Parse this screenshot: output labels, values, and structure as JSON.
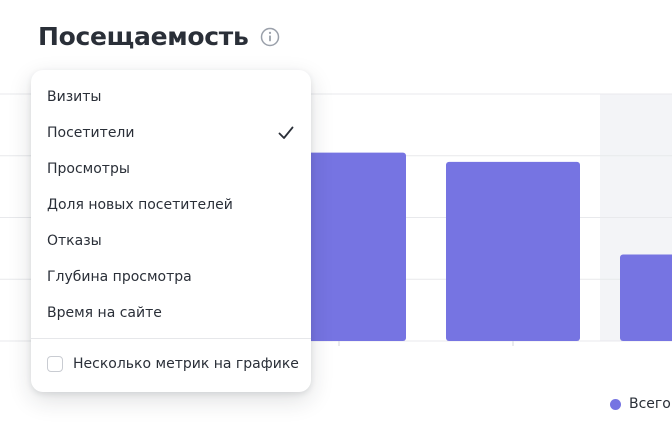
{
  "header": {
    "title": "Посещаемость"
  },
  "icons": {
    "info": "info-icon",
    "check": "check-icon"
  },
  "colors": {
    "bar": "#7674e2",
    "highlight": "#f3f4f7",
    "grid": "#e8e9ec",
    "text": "#2a2f38"
  },
  "metric_menu": {
    "items": [
      {
        "label": "Визиты",
        "selected": false
      },
      {
        "label": "Посетители",
        "selected": true
      },
      {
        "label": "Просмотры",
        "selected": false
      },
      {
        "label": "Доля новых посетителей",
        "selected": false
      },
      {
        "label": "Отказы",
        "selected": false
      },
      {
        "label": "Глубина просмотра",
        "selected": false
      },
      {
        "label": "Время на сайте",
        "selected": false
      }
    ],
    "multi_metric_label": "Несколько метрик на графике",
    "multi_metric_checked": false
  },
  "legend": {
    "label": "Всего"
  },
  "chart_data": {
    "type": "bar",
    "categories": [
      "",
      "",
      ""
    ],
    "series": [
      {
        "name": "Всего",
        "values": [
          3.05,
          2.9,
          1.4
        ]
      }
    ],
    "ylim": [
      0,
      4
    ],
    "grid": true,
    "legend_placement": "bottom-right"
  }
}
